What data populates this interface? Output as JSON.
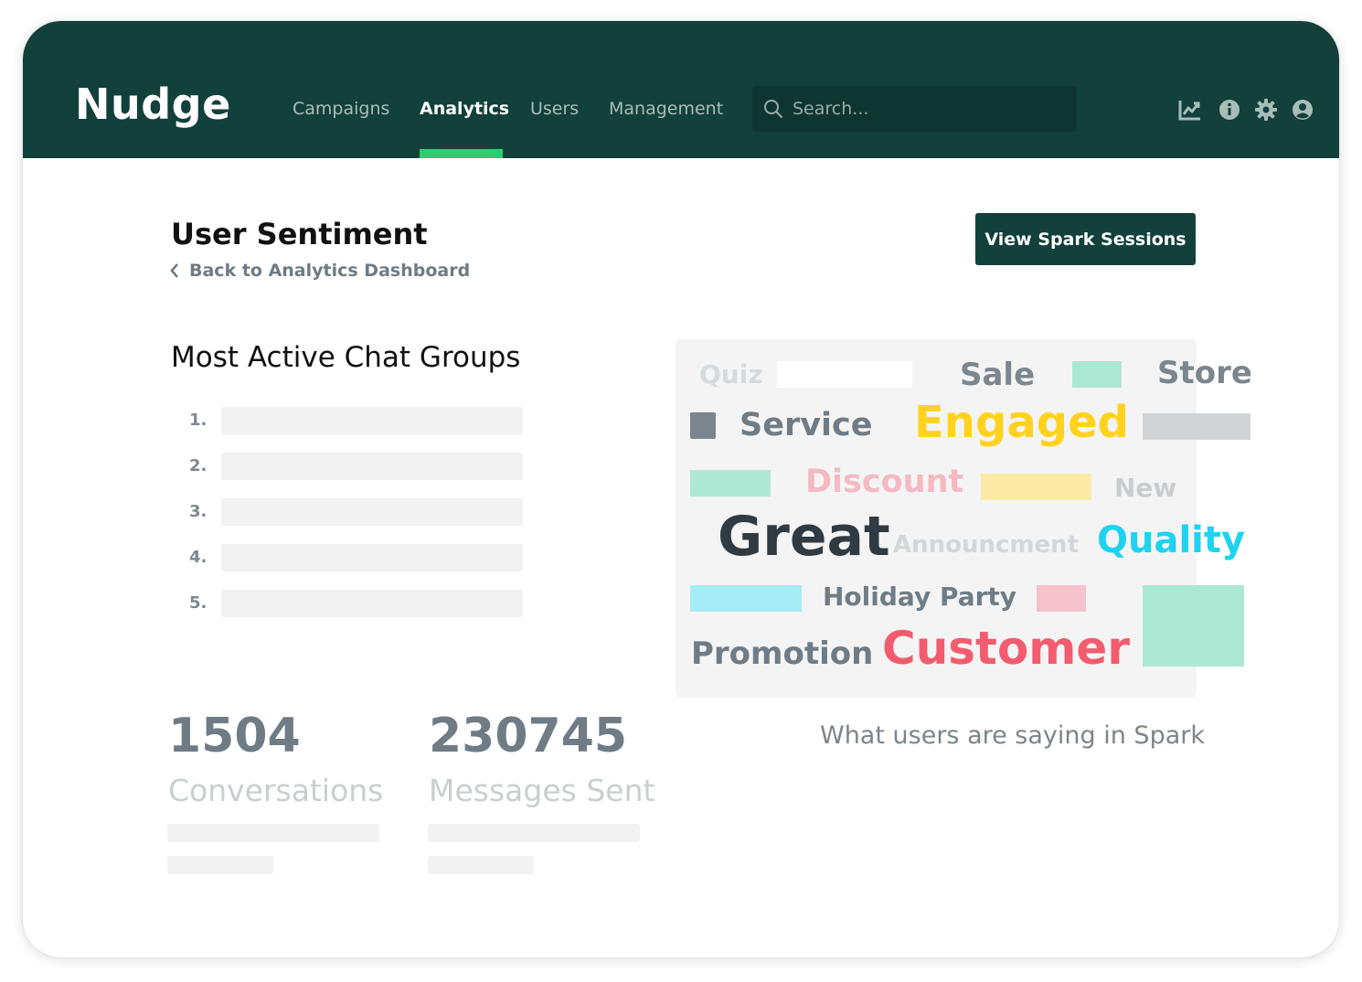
{
  "app": {
    "logo": "Nudge"
  },
  "nav": {
    "items": [
      {
        "label": "Campaigns",
        "active": false
      },
      {
        "label": "Analytics",
        "active": true
      },
      {
        "label": "Users",
        "active": false
      },
      {
        "label": "Management",
        "active": false
      }
    ]
  },
  "search": {
    "placeholder": "Search..."
  },
  "toolbar_icons": [
    "chart-line-icon",
    "info-icon",
    "gear-icon",
    "user-avatar-icon"
  ],
  "header": {
    "title": "User Sentiment",
    "back_label": "Back to Analytics Dashboard",
    "action_button": "View Spark Sessions"
  },
  "chat_groups": {
    "title": "Most Active Chat Groups",
    "ranks": [
      "1.",
      "2.",
      "3.",
      "4.",
      "5."
    ]
  },
  "stats": [
    {
      "value": "1504",
      "label": "Conversations"
    },
    {
      "value": "230745",
      "label": "Messages Sent"
    }
  ],
  "word_cloud": {
    "words": [
      {
        "text": "Quiz",
        "color": "#d6dadd"
      },
      {
        "text": "Sale",
        "color": "#7b868e"
      },
      {
        "text": "Store",
        "color": "#7b868e"
      },
      {
        "text": "Service",
        "color": "#6f7c85"
      },
      {
        "text": "Engaged",
        "color": "#ffd21f"
      },
      {
        "text": "Discount",
        "color": "#f5b9c4"
      },
      {
        "text": "New",
        "color": "#c9cdd0"
      },
      {
        "text": "Great",
        "color": "#2f3a42"
      },
      {
        "text": "Announcment",
        "color": "#d3d7da"
      },
      {
        "text": "Quality",
        "color": "#1ed3f0"
      },
      {
        "text": "Holiday Party",
        "color": "#6f7c85"
      },
      {
        "text": "Promotion",
        "color": "#6f7c85"
      },
      {
        "text": "Customer",
        "color": "#f25c6e"
      }
    ],
    "caption": "What users are saying in Spark"
  },
  "colors": {
    "topbar": "#12403a",
    "accent": "#2ecc71",
    "button": "#12403a"
  }
}
